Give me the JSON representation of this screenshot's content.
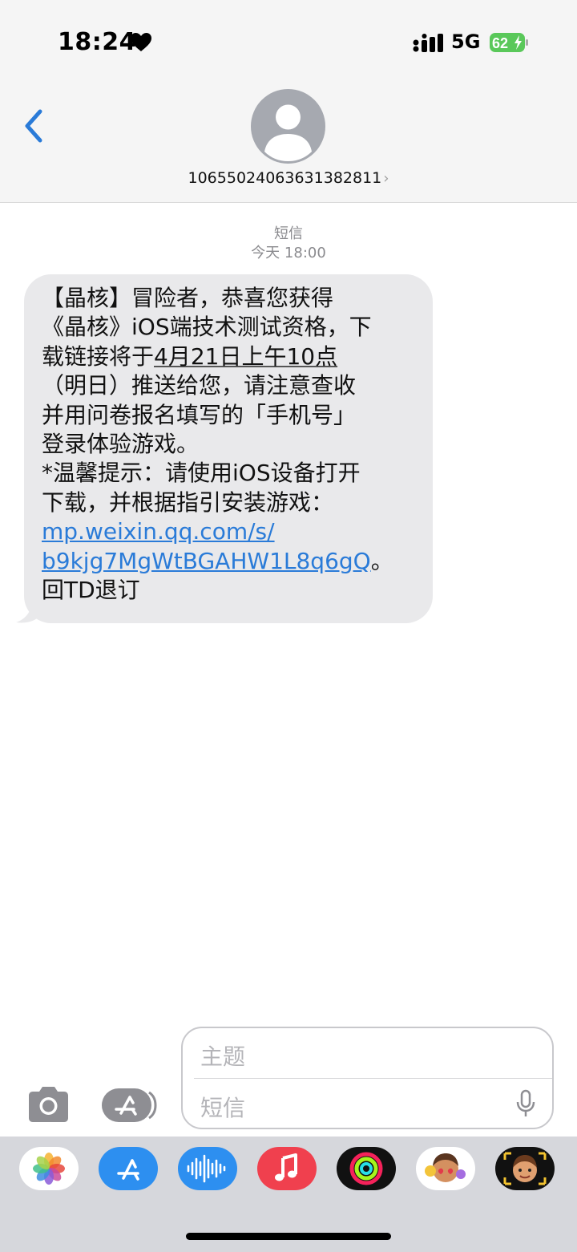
{
  "status_bar": {
    "time": "18:24",
    "network": "5G",
    "battery": "62",
    "heart_icon": "heart-icon",
    "signal_icon": "signal-icon"
  },
  "header": {
    "contact": "106550240636313828​11",
    "back_icon": "chevron-left-icon",
    "avatar_icon": "person-icon"
  },
  "conversation": {
    "service": "短信",
    "timestamp": "今天 18:00",
    "message_lines": [
      "【晶核】冒险者，恭喜您获得",
      "《晶核》iOS端技术测试资格，下",
      "载链接将于",
      "4月21日上午10点",
      "（明日）推送给您，请注意查收",
      "并用问卷报名填写的「手机号」",
      "登录体验游戏。",
      "*温馨提示：请使用iOS设备打开",
      "下载，并根据指引安装游戏：",
      "mp.weixin.qq.com/s/",
      "b9kjg7MgWtBGAHW1L8q6gQ",
      "。",
      "回TD退订"
    ]
  },
  "composer": {
    "subject_placeholder": "主题",
    "text_placeholder": "短信"
  },
  "app_strip": {
    "apps": [
      "photos-app-icon",
      "app-store-icon",
      "audio-messages-icon",
      "music-icon",
      "fitness-icon",
      "memoji-stickers-icon",
      "animoji-icon"
    ]
  },
  "colors": {
    "accent": "#2a7bd8",
    "bubble": "#e9e9eb",
    "strip": "#d6d7dc"
  }
}
